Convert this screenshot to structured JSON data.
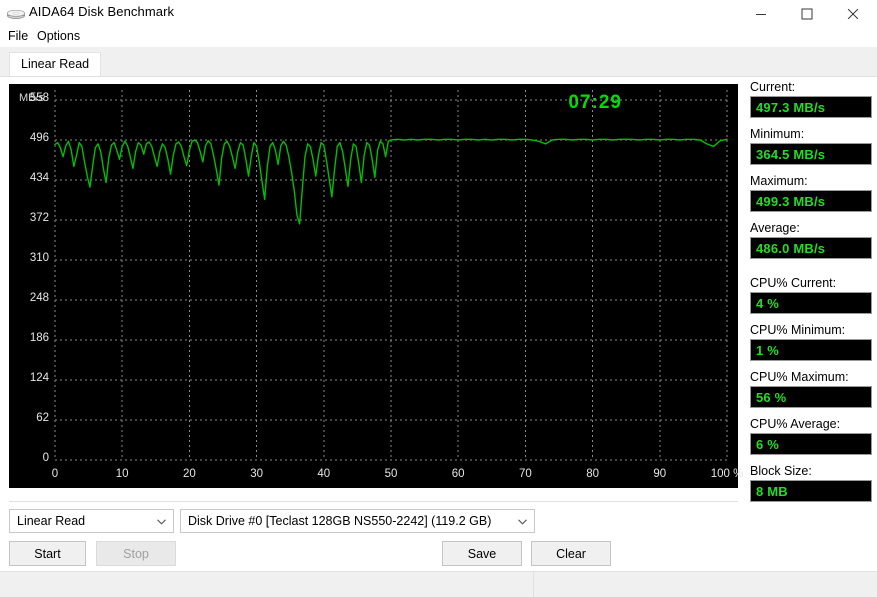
{
  "window": {
    "title": "AIDA64 Disk Benchmark",
    "icon": "disk-icon",
    "minimize": "minimize-icon",
    "maximize": "maximize-icon",
    "close": "close-icon"
  },
  "menu": {
    "items": [
      {
        "label": "File"
      },
      {
        "label": "Options"
      }
    ]
  },
  "tabs": [
    {
      "label": "Linear Read",
      "selected": true
    }
  ],
  "chart_data": {
    "type": "line",
    "title": "",
    "xlabel": "",
    "ylabel": "MB/s",
    "axis_unit": "MB/s",
    "timer": "07:29",
    "grid": true,
    "legend": "none",
    "line_color": "#00c000",
    "background": "#000000",
    "xlim": [
      0,
      100
    ],
    "ylim": [
      0,
      558
    ],
    "yticks": [
      0,
      62,
      124,
      186,
      248,
      310,
      372,
      434,
      496,
      558
    ],
    "ytick_labels": [
      "0",
      "62",
      "124",
      "186",
      "248",
      "310",
      "372",
      "434",
      "496",
      "558"
    ],
    "xticks": [
      0,
      10,
      20,
      30,
      40,
      50,
      60,
      70,
      80,
      90,
      100
    ],
    "xtick_labels": [
      "0",
      "10",
      "20",
      "30",
      "40",
      "50",
      "60",
      "70",
      "80",
      "90",
      "100 %"
    ],
    "series": [
      {
        "name": "Linear Read",
        "x": [
          0,
          0.4,
          0.8,
          1.2,
          1.6,
          2,
          2.4,
          2.8,
          3.2,
          3.6,
          4,
          4.4,
          4.8,
          5.2,
          5.6,
          6,
          6.4,
          6.8,
          7.2,
          7.6,
          8,
          8.4,
          8.8,
          9.2,
          9.6,
          10,
          10.4,
          10.8,
          11.2,
          11.6,
          12,
          12.4,
          12.8,
          13.2,
          13.6,
          14,
          14.4,
          14.8,
          15.2,
          15.6,
          16,
          16.4,
          16.8,
          17.2,
          17.6,
          18,
          18.4,
          18.8,
          19.2,
          19.6,
          20,
          20.4,
          20.8,
          21.2,
          21.6,
          22,
          22.4,
          22.8,
          23.2,
          23.6,
          24,
          24.4,
          24.8,
          25.2,
          25.6,
          26,
          26.4,
          26.8,
          27.2,
          27.6,
          28,
          28.4,
          28.8,
          29.2,
          29.6,
          30,
          30.4,
          30.8,
          31.2,
          31.6,
          32,
          32.4,
          32.8,
          33.2,
          33.6,
          34,
          34.4,
          34.8,
          35.2,
          35.6,
          36,
          36.4,
          36.8,
          37.2,
          37.6,
          38,
          38.4,
          38.8,
          39.2,
          39.6,
          40,
          40.4,
          40.8,
          41.2,
          41.6,
          42,
          42.4,
          42.8,
          43.2,
          43.6,
          44,
          44.4,
          44.8,
          45.2,
          45.6,
          46,
          46.4,
          46.8,
          47.2,
          47.6,
          48,
          48.4,
          48.8,
          49.2,
          49.6,
          50,
          51,
          52,
          53,
          54,
          55,
          56,
          57,
          58,
          59,
          60,
          61,
          62,
          63,
          64,
          65,
          66,
          67,
          68,
          69,
          70,
          71,
          72,
          73,
          74,
          75,
          76,
          77,
          78,
          79,
          80,
          81,
          82,
          83,
          84,
          85,
          86,
          87,
          88,
          89,
          90,
          91,
          92,
          93,
          94,
          95,
          96,
          97,
          98,
          99,
          100
        ],
        "values": [
          489,
          492,
          484,
          470,
          487,
          494,
          481,
          455,
          472,
          492,
          486,
          462,
          440,
          423,
          455,
          484,
          490,
          478,
          452,
          430,
          468,
          488,
          492,
          480,
          466,
          486,
          494,
          487,
          470,
          452,
          478,
          492,
          488,
          474,
          490,
          493,
          486,
          470,
          455,
          478,
          490,
          484,
          466,
          443,
          472,
          490,
          493,
          486,
          470,
          456,
          480,
          494,
          496,
          492,
          478,
          462,
          487,
          495,
          490,
          472,
          450,
          426,
          468,
          490,
          494,
          486,
          470,
          452,
          478,
          492,
          488,
          466,
          440,
          470,
          492,
          486,
          462,
          432,
          404,
          455,
          486,
          492,
          480,
          458,
          487,
          494,
          488,
          470,
          446,
          418,
          380,
          366,
          420,
          470,
          490,
          486,
          466,
          440,
          472,
          492,
          488,
          464,
          436,
          408,
          450,
          486,
          492,
          478,
          452,
          424,
          466,
          490,
          486,
          460,
          430,
          472,
          492,
          488,
          466,
          438,
          480,
          494,
          490,
          470,
          494,
          496,
          497,
          496,
          497,
          496,
          497,
          497,
          496,
          497,
          497,
          496,
          497,
          497,
          496,
          497,
          496,
          497,
          497,
          496,
          497,
          497,
          496,
          494,
          490,
          496,
          497,
          497,
          496,
          497,
          497,
          496,
          497,
          497,
          496,
          497,
          497,
          497,
          496,
          497,
          497,
          496,
          497,
          497,
          496,
          497,
          497,
          496,
          490,
          486,
          495,
          497,
          496
        ]
      }
    ]
  },
  "stats": [
    {
      "label": "Current:",
      "value": "497.3 MB/s",
      "gap": false
    },
    {
      "label": "Minimum:",
      "value": "364.5 MB/s",
      "gap": false
    },
    {
      "label": "Maximum:",
      "value": "499.3 MB/s",
      "gap": false
    },
    {
      "label": "Average:",
      "value": "486.0 MB/s",
      "gap": false
    },
    {
      "label": "CPU% Current:",
      "value": "4 %",
      "gap": true
    },
    {
      "label": "CPU% Minimum:",
      "value": "1 %",
      "gap": false
    },
    {
      "label": "CPU% Maximum:",
      "value": "56 %",
      "gap": false
    },
    {
      "label": "CPU% Average:",
      "value": "6 %",
      "gap": false
    },
    {
      "label": "Block Size:",
      "value": "8 MB",
      "gap": false
    }
  ],
  "controls": {
    "mode_select": {
      "value": "Linear Read"
    },
    "drive_select": {
      "value": "Disk Drive #0  [Teclast 128GB NS550-2242]  (119.2 GB)"
    },
    "start_button": "Start",
    "stop_button": "Stop",
    "save_button": "Save",
    "clear_button": "Clear"
  },
  "statusbar": {
    "left_text": "",
    "right_text": ""
  },
  "colors": {
    "accent_green": "#22dd22",
    "trace_green": "#00c000",
    "panel_black": "#000000"
  }
}
